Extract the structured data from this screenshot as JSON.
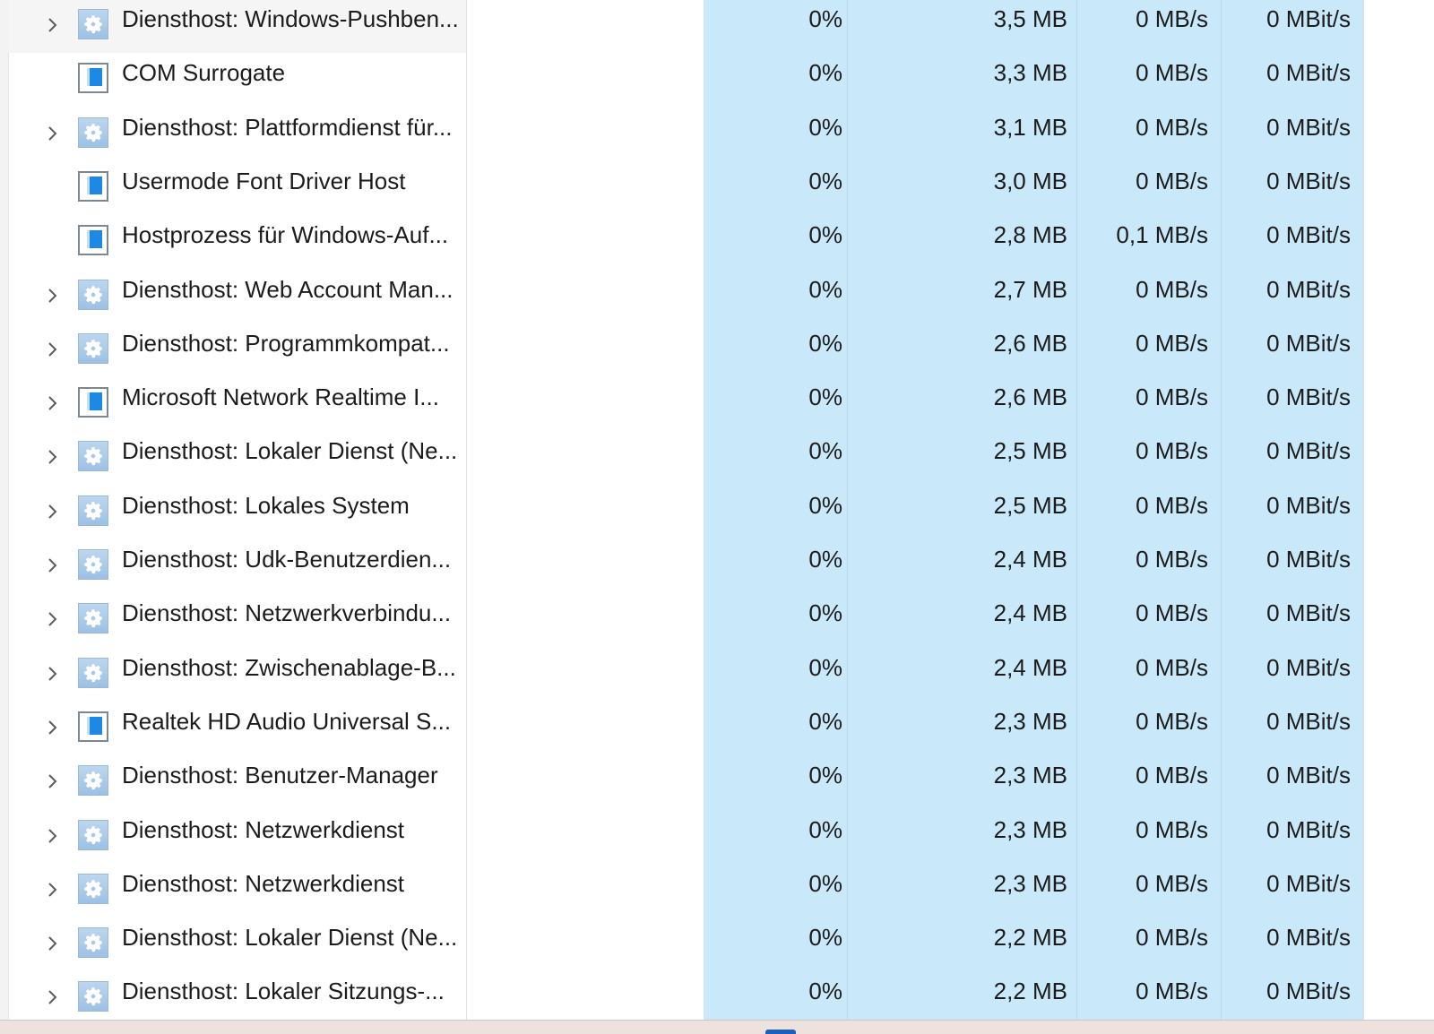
{
  "rows": [
    {
      "name": "Diensthost: Windows-Pushben...",
      "icon": "gear-icon",
      "expandable": true,
      "cpu": "0%",
      "memory": "3,5 MB",
      "disk": "0 MB/s",
      "network": "0 MBit/s"
    },
    {
      "name": "COM Surrogate",
      "icon": "window-icon",
      "expandable": false,
      "cpu": "0%",
      "memory": "3,3 MB",
      "disk": "0 MB/s",
      "network": "0 MBit/s"
    },
    {
      "name": "Diensthost: Plattformdienst für...",
      "icon": "gear-icon",
      "expandable": true,
      "cpu": "0%",
      "memory": "3,1 MB",
      "disk": "0 MB/s",
      "network": "0 MBit/s"
    },
    {
      "name": "Usermode Font Driver Host",
      "icon": "window-icon",
      "expandable": false,
      "cpu": "0%",
      "memory": "3,0 MB",
      "disk": "0 MB/s",
      "network": "0 MBit/s"
    },
    {
      "name": "Hostprozess für Windows-Auf...",
      "icon": "window-icon",
      "expandable": false,
      "cpu": "0%",
      "memory": "2,8 MB",
      "disk": "0,1 MB/s",
      "network": "0 MBit/s"
    },
    {
      "name": "Diensthost: Web Account Man...",
      "icon": "gear-icon",
      "expandable": true,
      "cpu": "0%",
      "memory": "2,7 MB",
      "disk": "0 MB/s",
      "network": "0 MBit/s"
    },
    {
      "name": "Diensthost: Programmkompat...",
      "icon": "gear-icon",
      "expandable": true,
      "cpu": "0%",
      "memory": "2,6 MB",
      "disk": "0 MB/s",
      "network": "0 MBit/s"
    },
    {
      "name": "Microsoft Network Realtime I...",
      "icon": "window-icon",
      "expandable": true,
      "cpu": "0%",
      "memory": "2,6 MB",
      "disk": "0 MB/s",
      "network": "0 MBit/s"
    },
    {
      "name": "Diensthost: Lokaler Dienst (Ne...",
      "icon": "gear-icon",
      "expandable": true,
      "cpu": "0%",
      "memory": "2,5 MB",
      "disk": "0 MB/s",
      "network": "0 MBit/s"
    },
    {
      "name": "Diensthost: Lokales System",
      "icon": "gear-icon",
      "expandable": true,
      "cpu": "0%",
      "memory": "2,5 MB",
      "disk": "0 MB/s",
      "network": "0 MBit/s"
    },
    {
      "name": "Diensthost: Udk-Benutzerdien...",
      "icon": "gear-icon",
      "expandable": true,
      "cpu": "0%",
      "memory": "2,4 MB",
      "disk": "0 MB/s",
      "network": "0 MBit/s"
    },
    {
      "name": "Diensthost: Netzwerkverbindu...",
      "icon": "gear-icon",
      "expandable": true,
      "cpu": "0%",
      "memory": "2,4 MB",
      "disk": "0 MB/s",
      "network": "0 MBit/s"
    },
    {
      "name": "Diensthost: Zwischenablage-B...",
      "icon": "gear-icon",
      "expandable": true,
      "cpu": "0%",
      "memory": "2,4 MB",
      "disk": "0 MB/s",
      "network": "0 MBit/s"
    },
    {
      "name": "Realtek HD Audio Universal S...",
      "icon": "window-icon",
      "expandable": true,
      "cpu": "0%",
      "memory": "2,3 MB",
      "disk": "0 MB/s",
      "network": "0 MBit/s"
    },
    {
      "name": "Diensthost: Benutzer-Manager",
      "icon": "gear-icon",
      "expandable": true,
      "cpu": "0%",
      "memory": "2,3 MB",
      "disk": "0 MB/s",
      "network": "0 MBit/s"
    },
    {
      "name": "Diensthost: Netzwerkdienst",
      "icon": "gear-icon",
      "expandable": true,
      "cpu": "0%",
      "memory": "2,3 MB",
      "disk": "0 MB/s",
      "network": "0 MBit/s"
    },
    {
      "name": "Diensthost: Netzwerkdienst",
      "icon": "gear-icon",
      "expandable": true,
      "cpu": "0%",
      "memory": "2,3 MB",
      "disk": "0 MB/s",
      "network": "0 MBit/s"
    },
    {
      "name": "Diensthost: Lokaler Dienst (Ne...",
      "icon": "gear-icon",
      "expandable": true,
      "cpu": "0%",
      "memory": "2,2 MB",
      "disk": "0 MB/s",
      "network": "0 MBit/s"
    },
    {
      "name": "Diensthost: Lokaler Sitzungs-...",
      "icon": "gear-icon",
      "expandable": true,
      "cpu": "0%",
      "memory": "2,2 MB",
      "disk": "0 MB/s",
      "network": "0 MBit/s"
    }
  ],
  "colors": {
    "heat_column": "#c9e8fa",
    "text": "#1b1b1b",
    "taskbar": "#eee2de",
    "taskbar_indicator": "#1c5fbf"
  }
}
